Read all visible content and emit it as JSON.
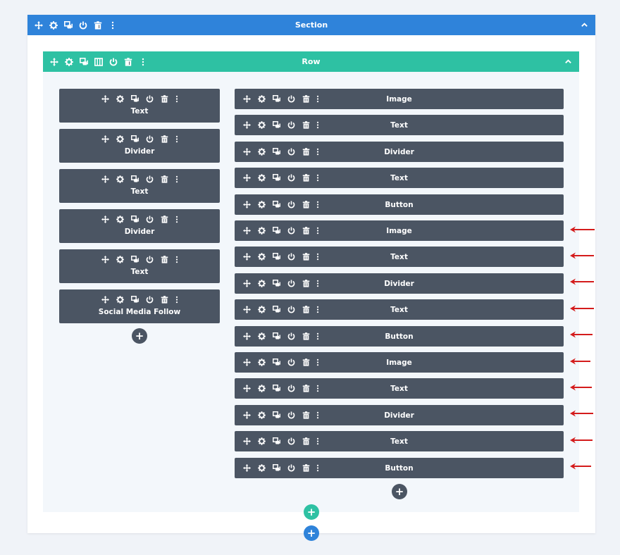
{
  "colors": {
    "section": "#2f83da",
    "row": "#2ec1a3",
    "module": "#4b5563",
    "arrow": "#d41c1c"
  },
  "section": {
    "title": "Section",
    "icons": [
      "move-icon",
      "gear-icon",
      "duplicate-icon",
      "power-icon",
      "trash-icon",
      "more-icon"
    ]
  },
  "row": {
    "title": "Row",
    "icons": [
      "move-icon",
      "gear-icon",
      "duplicate-icon",
      "columns-icon",
      "power-icon",
      "trash-icon",
      "more-icon"
    ]
  },
  "left_column": {
    "modules": [
      {
        "label": "Text"
      },
      {
        "label": "Divider"
      },
      {
        "label": "Text"
      },
      {
        "label": "Divider"
      },
      {
        "label": "Text"
      },
      {
        "label": "Social Media Follow"
      }
    ]
  },
  "right_column": {
    "modules": [
      {
        "label": "Image"
      },
      {
        "label": "Text"
      },
      {
        "label": "Divider"
      },
      {
        "label": "Text"
      },
      {
        "label": "Button"
      },
      {
        "label": "Image"
      },
      {
        "label": "Text"
      },
      {
        "label": "Divider"
      },
      {
        "label": "Text"
      },
      {
        "label": "Button"
      },
      {
        "label": "Image"
      },
      {
        "label": "Text"
      },
      {
        "label": "Divider"
      },
      {
        "label": "Text"
      },
      {
        "label": "Button"
      }
    ]
  },
  "buttons": {
    "add_module": "+",
    "add_row": "+",
    "add_section": "+"
  }
}
